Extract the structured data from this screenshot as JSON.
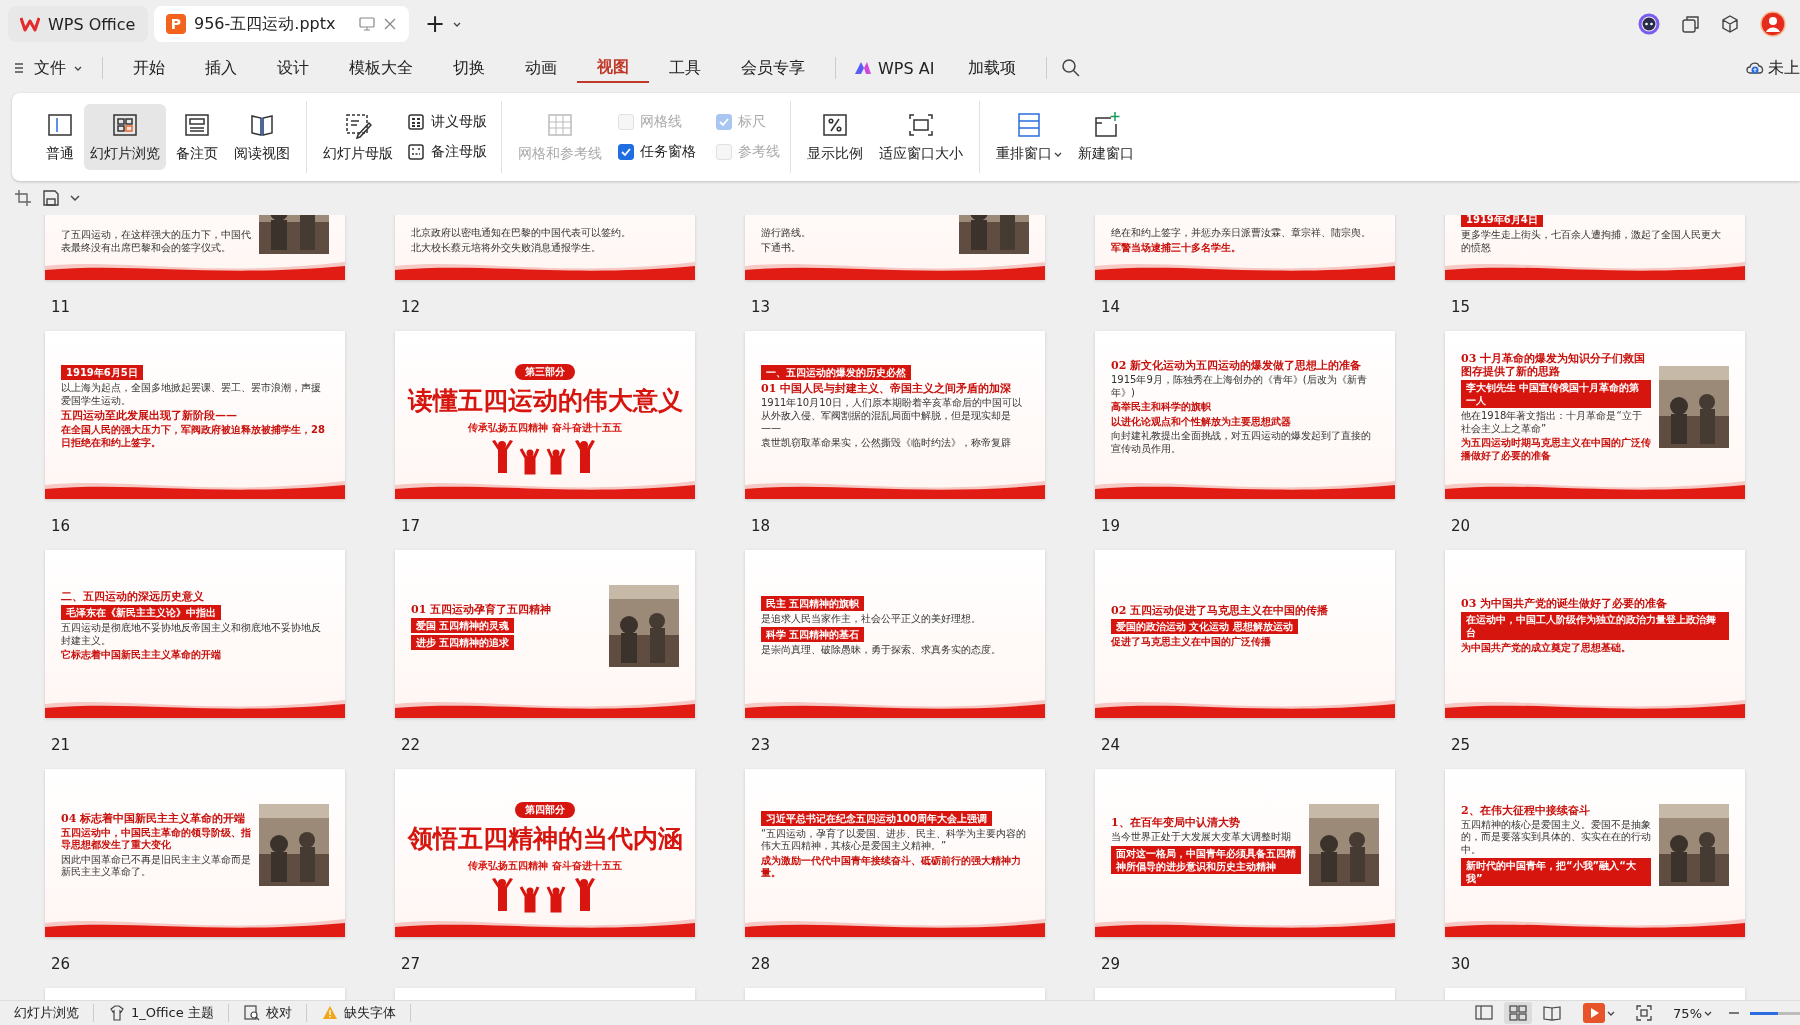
{
  "tabs": [
    {
      "kind": "home",
      "label": "WPS Office",
      "selected": false
    },
    {
      "kind": "file",
      "label": "956-五四运动.pptx",
      "icon_letter": "P",
      "selected": true
    }
  ],
  "new_tab": "+",
  "menu": {
    "file": "文件",
    "items": [
      {
        "label": "开始",
        "selected": false
      },
      {
        "label": "插入",
        "selected": false
      },
      {
        "label": "设计",
        "selected": false
      },
      {
        "label": "模板大全",
        "selected": false
      },
      {
        "label": "切换",
        "selected": false
      },
      {
        "label": "动画",
        "selected": false
      },
      {
        "label": "视图",
        "selected": true
      },
      {
        "label": "工具",
        "selected": false
      },
      {
        "label": "会员专享",
        "selected": false
      }
    ],
    "ai": "WPS AI",
    "addons": "加载项",
    "cloud": "未上"
  },
  "ribbon": [
    {
      "kind": "views",
      "items": [
        {
          "label": "普通",
          "selected": false
        },
        {
          "label": "幻灯片浏览",
          "selected": true
        },
        {
          "label": "备注页",
          "selected": false
        },
        {
          "label": "阅读视图",
          "selected": false
        }
      ]
    },
    {
      "kind": "masters",
      "big": "幻灯片母版",
      "small": [
        "讲义母版",
        "备注母版"
      ]
    },
    {
      "kind": "grid",
      "big": {
        "label": "网格和参考线",
        "disabled": true
      },
      "checks": [
        {
          "label": "网格线",
          "checked": false,
          "disabled": true
        },
        {
          "label": "标尺",
          "checked": true,
          "disabled": true
        },
        {
          "label": "任务窗格",
          "checked": true,
          "disabled": false
        },
        {
          "label": "参考线",
          "checked": false,
          "disabled": true
        }
      ]
    },
    {
      "kind": "zoom",
      "items": [
        "显示比例",
        "适应窗口大小"
      ]
    },
    {
      "kind": "window",
      "items": [
        {
          "label": "重排窗口",
          "dropdown": true
        },
        {
          "label": "新建窗口",
          "dropdown": false
        }
      ]
    }
  ],
  "slides": [
    {
      "kind": "tail",
      "number": "11",
      "photo": true,
      "blocks": [
        {
          "kind": "text",
          "text": "了五四运动，在这样强大的压力下，中国代表最终没有出席巴黎和会的签字仪式。"
        }
      ]
    },
    {
      "kind": "tail",
      "number": "12",
      "photo": false,
      "blocks": [
        {
          "kind": "text",
          "text": "北京政府以密电通知在巴黎的中国代表可以签约。"
        },
        {
          "kind": "text",
          "text": "北大校长蔡元培将外交失败消息通报学生。"
        }
      ]
    },
    {
      "kind": "tail",
      "number": "13",
      "photo": true,
      "blocks": [
        {
          "kind": "text",
          "text": "游行路线。"
        },
        {
          "kind": "text",
          "text": "下通书。"
        }
      ]
    },
    {
      "kind": "tail",
      "number": "14",
      "photo": false,
      "blocks": [
        {
          "kind": "text",
          "text": "绝在和约上签字，并惩办亲日派曹汝霖、章宗祥、陆宗舆。"
        },
        {
          "kind": "accent",
          "text": "军警当场逮捕三十多名学生。"
        }
      ]
    },
    {
      "kind": "tail",
      "number": "15",
      "photo": false,
      "blocks": [
        {
          "kind": "band",
          "text": "1919年6月4日"
        },
        {
          "kind": "text",
          "text": "更多学生走上街头，七百余人遭拘捕，激起了全国人民更大的愤怒"
        }
      ]
    },
    {
      "kind": "content",
      "number": "16",
      "photo": false,
      "blocks": [
        {
          "kind": "band",
          "text": "1919年6月5日"
        },
        {
          "kind": "text",
          "text": "以上海为起点，全国多地掀起罢课、罢工、罢市浪潮，声援爱国学生运动。"
        },
        {
          "kind": "heading",
          "text": "五四运动至此发展出现了新阶段——"
        },
        {
          "kind": "accent",
          "text": "在全国人民的强大压力下，军阀政府被迫释放被捕学生，28日拒绝在和约上签字。"
        }
      ]
    },
    {
      "kind": "section",
      "number": "17",
      "badge": "第三部分",
      "title": "读懂五四运动的伟大意义",
      "subtitle": "传承弘扬五四精神 奋斗奋进十五五"
    },
    {
      "kind": "content",
      "number": "18",
      "photo": false,
      "blocks": [
        {
          "kind": "band",
          "text": "一、五四运动的爆发的历史必然"
        },
        {
          "kind": "heading",
          "text": "01 中国人民与封建主义、帝国主义之间矛盾的加深"
        },
        {
          "kind": "text",
          "text": "1911年10月10日，人们原本期盼着辛亥革命后的中国可以从外敌入侵、军阀割据的混乱局面中解脱，但是现实却是——"
        },
        {
          "kind": "text",
          "text": "袁世凯窃取革命果实，公然撕毁《临时约法》，称帝复辟"
        }
      ]
    },
    {
      "kind": "content",
      "number": "19",
      "photo": false,
      "blocks": [
        {
          "kind": "heading",
          "text": "02 新文化运动为五四运动的爆发做了思想上的准备"
        },
        {
          "kind": "text",
          "text": "1915年9月，陈独秀在上海创办的《青年》(后改为《新青年》)"
        },
        {
          "kind": "accent",
          "text": "高举民主和科学的旗帜"
        },
        {
          "kind": "accent",
          "text": "以进化论观点和个性解放为主要思想武器"
        },
        {
          "kind": "text",
          "text": "向封建礼教提出全面挑战，对五四运动的爆发起到了直接的宣传动员作用。"
        }
      ]
    },
    {
      "kind": "content",
      "number": "20",
      "photo": true,
      "blocks": [
        {
          "kind": "heading",
          "text": "03 十月革命的爆发为知识分子们救国图存提供了新的思路"
        },
        {
          "kind": "band",
          "text": "李大钊先生 中国宣传俄国十月革命的第一人"
        },
        {
          "kind": "text",
          "text": "他在1918年著文指出：十月革命是“立于社会主义上之革命”"
        },
        {
          "kind": "accent",
          "text": "为五四运动时期马克思主义在中国的广泛传播做好了必要的准备"
        }
      ]
    },
    {
      "kind": "content",
      "number": "21",
      "photo": false,
      "blocks": [
        {
          "kind": "heading",
          "text": "二、五四运动的深远历史意义"
        },
        {
          "kind": "band",
          "text": "毛泽东在《新民主主义论》中指出"
        },
        {
          "kind": "text",
          "text": "五四运动是彻底地不妥协地反帝国主义和彻底地不妥协地反封建主义。"
        },
        {
          "kind": "accent",
          "text": "它标志着中国新民主主义革命的开端"
        }
      ]
    },
    {
      "kind": "content",
      "number": "22",
      "photo": true,
      "blocks": [
        {
          "kind": "heading",
          "text": "01 五四运动孕育了五四精神"
        },
        {
          "kind": "band",
          "text": "爱国 五四精神的灵魂"
        },
        {
          "kind": "band",
          "text": "进步 五四精神的追求"
        }
      ]
    },
    {
      "kind": "content",
      "number": "23",
      "photo": false,
      "blocks": [
        {
          "kind": "band",
          "text": "民主 五四精神的旗帜"
        },
        {
          "kind": "text",
          "text": "是追求人民当家作主，社会公平正义的美好理想。"
        },
        {
          "kind": "band",
          "text": "科学 五四精神的基石"
        },
        {
          "kind": "text",
          "text": "是崇尚真理、破除愚昧，勇于探索、求真务实的态度。"
        }
      ]
    },
    {
      "kind": "content",
      "number": "24",
      "photo": false,
      "blocks": [
        {
          "kind": "heading",
          "text": "02 五四运动促进了马克思主义在中国的传播"
        },
        {
          "kind": "band",
          "text": "爱国的政治运动 文化运动 思想解放运动"
        },
        {
          "kind": "accent",
          "text": "促进了马克思主义在中国的广泛传播"
        }
      ]
    },
    {
      "kind": "content",
      "number": "25",
      "photo": false,
      "blocks": [
        {
          "kind": "heading",
          "text": "03 为中国共产党的诞生做好了必要的准备"
        },
        {
          "kind": "band",
          "text": "在运动中，中国工人阶级作为独立的政治力量登上政治舞台"
        },
        {
          "kind": "accent",
          "text": "为中国共产党的成立奠定了思想基础。"
        }
      ]
    },
    {
      "kind": "content",
      "number": "26",
      "photo": true,
      "blocks": [
        {
          "kind": "heading",
          "text": "04 标志着中国新民主主义革命的开端"
        },
        {
          "kind": "accent",
          "text": "五四运动中，中国民主革命的领导阶级、指导思想都发生了重大变化"
        },
        {
          "kind": "text",
          "text": "因此中国革命已不再是旧民主主义革命而是新民主主义革命了。"
        }
      ]
    },
    {
      "kind": "section",
      "number": "27",
      "badge": "第四部分",
      "title": "领悟五四精神的当代内涵",
      "subtitle": "传承弘扬五四精神 奋斗奋进十五五"
    },
    {
      "kind": "content",
      "number": "28",
      "photo": false,
      "blocks": [
        {
          "kind": "band",
          "text": "习近平总书记在纪念五四运动100周年大会上强调"
        },
        {
          "kind": "text",
          "text": "“五四运动，孕育了以爱国、进步、民主、科学为主要内容的伟大五四精神，其核心是爱国主义精神。”"
        },
        {
          "kind": "accent",
          "text": "成为激励一代代中国青年接续奋斗、砥砺前行的强大精神力量。"
        }
      ]
    },
    {
      "kind": "content",
      "number": "29",
      "photo": true,
      "blocks": [
        {
          "kind": "heading",
          "text": "1、在百年变局中认清大势"
        },
        {
          "kind": "text",
          "text": "当今世界正处于大发展大变革大调整时期"
        },
        {
          "kind": "band",
          "text": "面对这一格局，中国青年必须具备五四精神所倡导的进步意识和历史主动精神"
        }
      ]
    },
    {
      "kind": "content",
      "number": "30",
      "photo": true,
      "blocks": [
        {
          "kind": "heading",
          "text": "2、在伟大征程中接续奋斗"
        },
        {
          "kind": "text",
          "text": "五四精神的核心是爱国主义。爱国不是抽象的，而是要落实到具体的、实实在在的行动中。"
        },
        {
          "kind": "band",
          "text": "新时代的中国青年，把“小我”融入“大我”"
        }
      ]
    },
    {
      "kind": "blank"
    },
    {
      "kind": "blank"
    },
    {
      "kind": "blank"
    },
    {
      "kind": "blank"
    },
    {
      "kind": "blank"
    }
  ],
  "status_bar": {
    "items": [
      {
        "kind": "plain",
        "label": "幻灯片浏览"
      },
      {
        "kind": "theme",
        "label": "1_Office 主题"
      },
      {
        "kind": "proof",
        "label": "校对"
      },
      {
        "kind": "warning",
        "label": "缺失字体"
      }
    ],
    "views": [
      {
        "kind": "normal",
        "selected": false
      },
      {
        "kind": "sorter",
        "selected": true
      },
      {
        "kind": "reading",
        "selected": false
      }
    ],
    "zoom": "75%",
    "zoom_slider": {
      "level": 0.55
    }
  }
}
